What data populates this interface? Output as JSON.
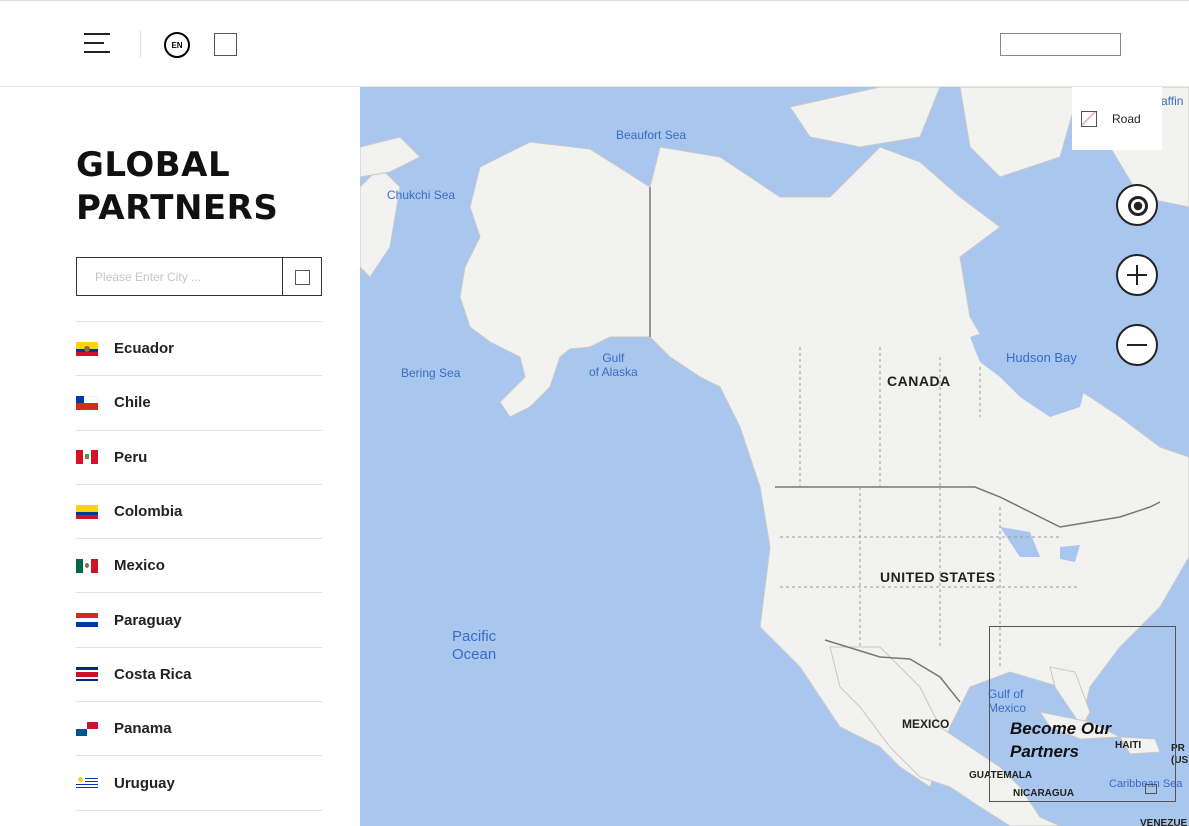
{
  "header": {
    "lang": "EN"
  },
  "sidebar": {
    "title_line1": "GLOBAL",
    "title_line2": "PARTNERS",
    "search_placeholder": "Please Enter City ...",
    "countries": [
      {
        "label": "Ecuador",
        "flag": "ecuador-flag"
      },
      {
        "label": "Chile",
        "flag": "chile-flag"
      },
      {
        "label": "Peru",
        "flag": "peru-flag"
      },
      {
        "label": "Colombia",
        "flag": "colombia-flag"
      },
      {
        "label": "Mexico",
        "flag": "mexico-flag"
      },
      {
        "label": "Paraguay",
        "flag": "paraguay-flag"
      },
      {
        "label": "Costa Rica",
        "flag": "costa-rica-flag"
      },
      {
        "label": "Panama",
        "flag": "panama-flag"
      },
      {
        "label": "Uruguay",
        "flag": "uruguay-flag"
      }
    ]
  },
  "map": {
    "style_label": "Road",
    "labels": {
      "beaufort": "Beaufort Sea",
      "chukchi": "Chukchi Sea",
      "bering": "Bering Sea",
      "alaska_gulf_1": "Gulf",
      "alaska_gulf_2": "of Alaska",
      "hudson": "Hudson Bay",
      "canada": "CANADA",
      "us": "UNITED STATES",
      "pacific_1": "Pacific",
      "pacific_2": "Ocean",
      "mexico_gulf_1": "Gulf of",
      "mexico_gulf_2": "Mexico",
      "mexico": "MEXICO",
      "guatemala": "GUATEMALA",
      "nicaragua": "NICARAGUA",
      "haiti": "HAITI",
      "pr_1": "PR",
      "pr_2": "(US)",
      "caribbean": "Caribbean Sea",
      "baffin": "Baffin",
      "venezuela": "VENEZUE"
    },
    "partner_cta_line1": "Become Our",
    "partner_cta_line2": "Partners"
  },
  "colors": {
    "water": "#a9c6ef",
    "land": "#f2f2f0",
    "accent": "#111111"
  }
}
